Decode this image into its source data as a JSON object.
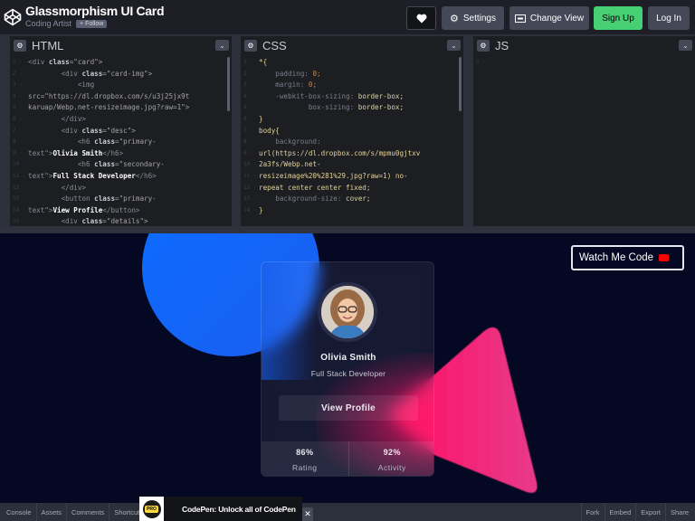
{
  "header": {
    "title": "Glassmorphism UI Card",
    "author": "Coding Artist",
    "follow_label": "+ Follow",
    "settings_label": "Settings",
    "change_view_label": "Change View",
    "signup_label": "Sign Up",
    "login_label": "Log In",
    "colors": {
      "signup": "#47cf73",
      "header_bg": "#1e1f26"
    }
  },
  "editors": {
    "html": {
      "title": "HTML",
      "lines": [
        [
          "<div ",
          "class",
          "=\"card\">"
        ],
        [
          "        <div ",
          "class",
          "=\"card-img\">"
        ],
        [
          "            <img"
        ],
        [
          "src=\"https://dl.dropbox.com/s/u3j25jx9t"
        ],
        [
          "karuap/Webp.net-resizeimage.jpg?raw=1\">"
        ],
        [
          "        </div>"
        ],
        [
          "        <div ",
          "class",
          "=\"desc\">"
        ],
        [
          "            <h6 ",
          "class",
          "=\"primary-"
        ],
        [
          "text\">",
          "Olivia Smith",
          "</h6>"
        ],
        [
          "            <h6 ",
          "class",
          "=\"secondary-"
        ],
        [
          "text\">",
          "Full Stack Developer",
          "</h6>"
        ],
        [
          "        </div>"
        ],
        [
          "        <button ",
          "class",
          "=\"primary-"
        ],
        [
          "text\">",
          "View Profile",
          "</button>"
        ],
        [
          "        <div ",
          "class",
          "=\"details\">"
        ]
      ]
    },
    "css": {
      "title": "CSS",
      "lines": [
        "*{",
        "    padding: 0;",
        "    margin: 0;",
        "    -webkit-box-sizing: border-box;",
        "            box-sizing: border-box;",
        "}",
        "body{",
        "    background:",
        "url(https://dl.dropbox.com/s/mpmu0gjtxv",
        "2a3fs/Webp.net-",
        "resizeimage%20%281%29.jpg?raw=1) no-",
        "repeat center center fixed;",
        "    background-size: cover;",
        "}"
      ]
    },
    "js": {
      "title": "JS",
      "lines": [
        ""
      ]
    }
  },
  "preview": {
    "card": {
      "name": "Olivia Smith",
      "role": "Full Stack Developer",
      "button_label": "View Profile",
      "stats": [
        {
          "value": "86%",
          "label": "Rating"
        },
        {
          "value": "92%",
          "label": "Activity"
        }
      ]
    },
    "watch_label": "Watch Me Code",
    "colors": {
      "background": "#050823",
      "circle": "#0b6cff",
      "triangle": "#ff1a6e"
    }
  },
  "bottombar": {
    "left": [
      "Console",
      "Assets",
      "Comments",
      "Shortcuts"
    ],
    "right": [
      "Fork",
      "Embed",
      "Export",
      "Share"
    ],
    "pro_badge": "PRO",
    "pro_text": "CodePen: Unlock all of CodePen",
    "close_icon": "✕"
  }
}
